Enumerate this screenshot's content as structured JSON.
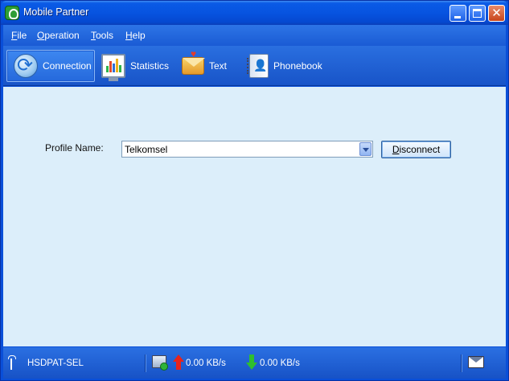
{
  "window": {
    "title": "Mobile Partner",
    "icon": "app-logo-icon",
    "controls": [
      "minimize",
      "maximize",
      "close"
    ]
  },
  "menu": {
    "items": [
      {
        "label_rest": "ile",
        "accel": "F"
      },
      {
        "label_rest": "peration",
        "accel": "O"
      },
      {
        "label_rest": "ools",
        "accel": "T"
      },
      {
        "label_rest": "elp",
        "accel": "H"
      }
    ]
  },
  "toolbar": {
    "tabs": [
      {
        "label": "Connection",
        "icon": "connection-icon",
        "active": true
      },
      {
        "label": "Statistics",
        "icon": "statistics-icon",
        "active": false
      },
      {
        "label": "Text",
        "icon": "text-message-icon",
        "active": false
      },
      {
        "label": "Phonebook",
        "icon": "phonebook-icon",
        "active": false
      }
    ]
  },
  "connection": {
    "profile_label": "Profile Name:",
    "profile_value": "Telkomsel",
    "button_accel": "D",
    "button_rest": "isconnect"
  },
  "status": {
    "network_type": "HSDPA",
    "carrier": "T-SEL",
    "upload_rate": "0.00 KB/s",
    "download_rate": "0.00 KB/s"
  },
  "colors": {
    "accent": "#1a5bd4",
    "content_bg": "#dceefa",
    "upload_arrow": "#e8231b",
    "download_arrow": "#2fbf2f"
  }
}
